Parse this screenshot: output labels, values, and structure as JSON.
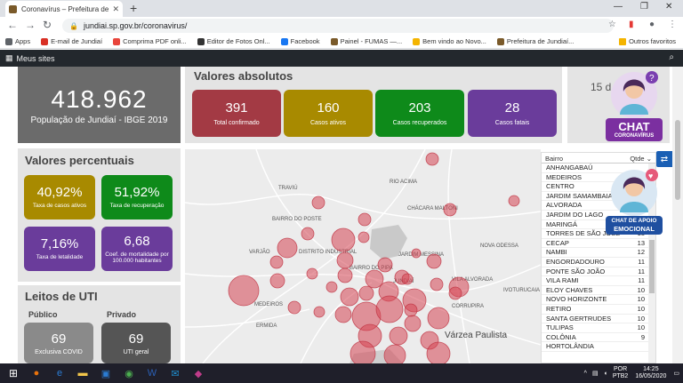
{
  "browser": {
    "tab_title": "Coronavírus – Prefeitura de Jundiaí",
    "url": "jundiai.sp.gov.br/coronavirus/",
    "bookmarks": [
      {
        "label": "Apps",
        "color": "#5f6368"
      },
      {
        "label": "E-mail de Jundiaí",
        "color": "#d93025"
      },
      {
        "label": "Comprima PDF onli...",
        "color": "#e8453c"
      },
      {
        "label": "Editor de Fotos Onl...",
        "color": "#333333"
      },
      {
        "label": "Facebook",
        "color": "#1877f2"
      },
      {
        "label": "Painel - FUMAS —...",
        "color": "#7a5a2a"
      },
      {
        "label": "Bem vindo ao Novo...",
        "color": "#f4b400"
      },
      {
        "label": "Prefeitura de Jundiaí...",
        "color": "#7a5a2a"
      }
    ],
    "other_bookmarks": "Outros favoritos"
  },
  "site": {
    "my_sites": "Meus sites"
  },
  "population": {
    "value": "418.962",
    "label": "População de Jundiaí - IBGE 2019"
  },
  "absolute": {
    "title": "Valores absolutos",
    "boxes": [
      {
        "value": "391",
        "label": "Total confirmado",
        "color": "#a33a44"
      },
      {
        "value": "160",
        "label": "Casos ativos",
        "color": "#a88a00"
      },
      {
        "value": "203",
        "label": "Casos recuperados",
        "color": "#0e8a1a"
      },
      {
        "value": "28",
        "label": "Casos fatais",
        "color": "#6a3c9b"
      }
    ]
  },
  "right_card_text": "15 d",
  "percent": {
    "title": "Valores percentuais",
    "boxes": [
      {
        "value": "40,92%",
        "label": "Taxa de casos ativos",
        "color": "#a88a00"
      },
      {
        "value": "51,92%",
        "label": "Taxa de recuperação",
        "color": "#0e8a1a"
      },
      {
        "value": "7,16%",
        "label": "Taxa de letalidade",
        "color": "#6a3c9b"
      },
      {
        "value": "6,68",
        "label": "Coef. de mortalidade por 100.000 habitantes",
        "color": "#6a3c9b"
      }
    ]
  },
  "uti": {
    "title": "Leitos de UTI",
    "public_label": "Público",
    "private_label": "Privado",
    "public_value": "69",
    "public_desc": "Exclusiva COVID",
    "private_value": "69",
    "private_desc": "UTI geral"
  },
  "map": {
    "labels": [
      "TRAVIÚ",
      "RIO ACIMA",
      "CHÁCARA MALTONI",
      "BAIRRO DO POSTE",
      "VARJÃO",
      "DISTRITO INDUSTRIAL",
      "JARDIM MESSINA",
      "NOVA ODESSA",
      "VILA ALVORADA",
      "MEDEIROS",
      "ERMIDA",
      "CORRUPIRA",
      "IVOTURUCAIA",
      "Várzea Paulista",
      "JUNDIAÍ",
      "BAIRRO DO PIPA"
    ]
  },
  "table": {
    "col_bairro": "Bairro",
    "col_qtde": "Qtde",
    "rows": [
      {
        "bairro": "ANHANGABAÚ",
        "qtde": ""
      },
      {
        "bairro": "MEDEIROS",
        "qtde": ""
      },
      {
        "bairro": "CENTRO",
        "qtde": ""
      },
      {
        "bairro": "JARDIM SAMAMBAIA",
        "qtde": ""
      },
      {
        "bairro": "ALVORADA",
        "qtde": ""
      },
      {
        "bairro": "JARDIM DO LAGO",
        "qtde": ""
      },
      {
        "bairro": "MARINGÁ",
        "qtde": ""
      },
      {
        "bairro": "TORRES DE SÃO JOSÉ",
        "qtde": "15"
      },
      {
        "bairro": "CECAP",
        "qtde": "13"
      },
      {
        "bairro": "NAMBI",
        "qtde": "12"
      },
      {
        "bairro": "ENGORDADOURO",
        "qtde": "11"
      },
      {
        "bairro": "PONTE SÃO JOÃO",
        "qtde": "11"
      },
      {
        "bairro": "VILA RAMI",
        "qtde": "11"
      },
      {
        "bairro": "ELOY CHAVES",
        "qtde": "10"
      },
      {
        "bairro": "NOVO HORIZONTE",
        "qtde": "10"
      },
      {
        "bairro": "RETIRO",
        "qtde": "10"
      },
      {
        "bairro": "SANTA GERTRUDES",
        "qtde": "10"
      },
      {
        "bairro": "TULIPAS",
        "qtde": "10"
      },
      {
        "bairro": "COLÔNIA",
        "qtde": "9"
      },
      {
        "bairro": "HORTOLÂNDIA",
        "qtde": ""
      }
    ]
  },
  "chat": {
    "label1": "CHAT",
    "label1_sub": "CORONAVÍRUS",
    "label2": "CHAT DE APOIO",
    "label2_sub": "EMOCIONAL"
  },
  "taskbar": {
    "lang_top": "POR",
    "lang_bottom": "PTB2",
    "time": "14:25",
    "date": "16/05/2020"
  }
}
